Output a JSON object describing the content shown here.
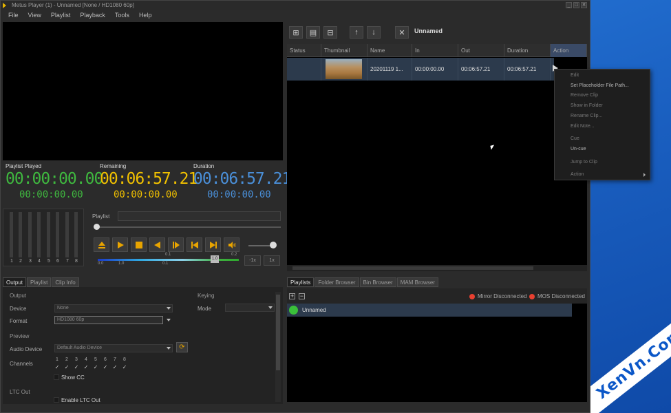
{
  "window": {
    "title": "Metus Player (1) - Unnamed [None / HD1080 60p]",
    "controls": [
      "_",
      "□",
      "✕"
    ]
  },
  "menu": [
    "File",
    "View",
    "Playlist",
    "Playback",
    "Tools",
    "Help"
  ],
  "timers": {
    "played": {
      "label": "Playlist Played",
      "big": "00:00:00.00",
      "small": "00:00:00.00",
      "color": "#3fb83f"
    },
    "remaining": {
      "label": "Remaining",
      "big": "00:06:57.21",
      "small": "00:00:00.00",
      "color": "#f0c000"
    },
    "duration": {
      "label": "Duration",
      "big": "00:06:57.21",
      "small": "00:00:00.00",
      "color": "#4a8fd8"
    }
  },
  "meters": {
    "channels": [
      "1",
      "2",
      "3",
      "4",
      "5",
      "6",
      "7",
      "8"
    ]
  },
  "playlist_progress": {
    "label": "Playlist"
  },
  "transport": {
    "buttons": [
      "eject-icon",
      "play-icon",
      "stop-icon",
      "rewind-icon",
      "step-forward-icon",
      "previous-icon",
      "next-icon",
      "volume-icon"
    ],
    "accent": "#e8a400"
  },
  "audio_scale": {
    "marker": "1.0",
    "ticks": [
      "0.0",
      "1.0",
      "0.1",
      "0.1",
      "0.2"
    ]
  },
  "mini_buttons": [
    "-1x",
    "1x"
  ],
  "left_tabs": [
    "Output",
    "Playlist",
    "Clip Info"
  ],
  "output": {
    "section": "Output",
    "device_label": "Device",
    "device_value": "None",
    "format_label": "Format",
    "format_value": "HD1080 60p",
    "preview_section": "Preview",
    "audio_device_label": "Audio Device",
    "audio_device_value": "Default Audio Device",
    "channels_label": "Channels",
    "channels": [
      "1",
      "2",
      "3",
      "4",
      "5",
      "6",
      "7",
      "8"
    ],
    "show_cc": "Show CC",
    "ltc_section": "LTC Out",
    "enable_ltc": "Enable LTC Out",
    "keying_section": "Keying",
    "mode_label": "Mode"
  },
  "playlist_toolbar": {
    "name": "Unnamed"
  },
  "grid": {
    "columns": [
      "Status",
      "Thumbnail",
      "Name",
      "In",
      "Out",
      "Duration",
      "Action"
    ],
    "rows": [
      {
        "name": "20201119 1...",
        "in": "00:00:00.00",
        "out": "00:06:57.21",
        "duration": "00:06:57.21"
      }
    ]
  },
  "context_menu": {
    "items": [
      {
        "label": "Edit",
        "enabled": false
      },
      {
        "label": "Set Placeholder File Path...",
        "enabled": true
      },
      {
        "label": "Remove Clip",
        "enabled": false
      },
      {
        "label": "Show in Folder",
        "enabled": false
      },
      {
        "label": "Rename Clip...",
        "enabled": false
      },
      {
        "label": "Edit Note...",
        "enabled": false
      },
      {
        "label": "Cue",
        "enabled": false
      },
      {
        "label": "Un-cue",
        "enabled": true
      },
      {
        "label": "Jump to Clip",
        "enabled": false
      },
      {
        "label": "Action",
        "enabled": false
      }
    ]
  },
  "right_tabs": [
    "Playlists",
    "Folder Browser",
    "Bin Browser",
    "MAM Browser"
  ],
  "connections": {
    "mirror": "Mirror Disconnected",
    "mos": "MOS Disconnected",
    "status_color": "#e84030"
  },
  "playlists": [
    {
      "name": "Unnamed",
      "led_color": "#3ac03a"
    }
  ],
  "watermark": "XenVn.Com"
}
